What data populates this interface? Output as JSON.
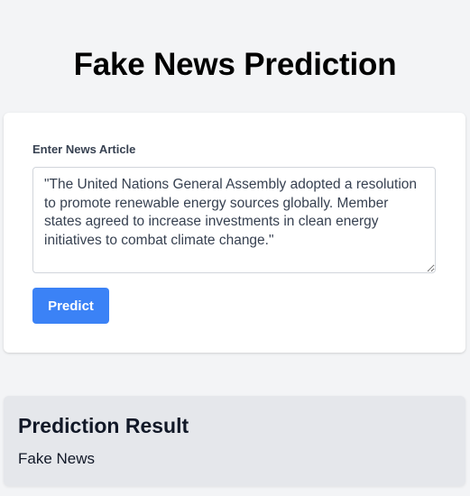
{
  "page": {
    "title": "Fake News Prediction"
  },
  "form": {
    "label": "Enter News Article",
    "article_text": "\"The United Nations General Assembly adopted a resolution to promote renewable energy sources globally. Member states agreed to increase investments in clean energy initiatives to combat climate change.\"",
    "submit_label": "Predict"
  },
  "result": {
    "title": "Prediction Result",
    "value": "Fake News"
  },
  "colors": {
    "background": "#f3f4f6",
    "card": "#ffffff",
    "result_card": "#e5e7eb",
    "accent": "#3b82f6"
  }
}
